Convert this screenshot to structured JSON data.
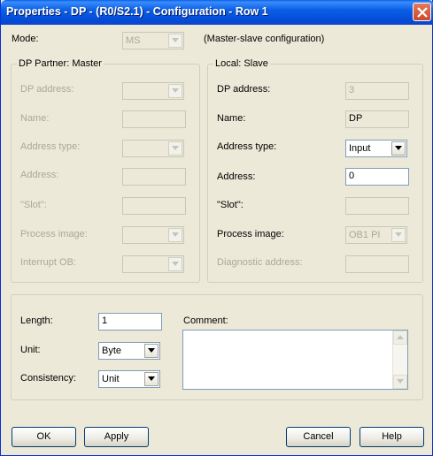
{
  "window": {
    "title": "Properties - DP - (R0/S2.1) - Configuration - Row 1"
  },
  "mode": {
    "label": "Mode:",
    "value": "MS",
    "description": "(Master-slave configuration)"
  },
  "partner": {
    "legend": "DP Partner: Master",
    "dp_address_label": "DP address:",
    "name_label": "Name:",
    "address_type_label": "Address type:",
    "address_label": "Address:",
    "slot_label": "\"Slot\":",
    "process_image_label": "Process image:",
    "interrupt_ob_label": "Interrupt OB:"
  },
  "local": {
    "legend": "Local: Slave",
    "dp_address_label": "DP address:",
    "dp_address_value": "3",
    "name_label": "Name:",
    "name_value": "DP",
    "address_type_label": "Address type:",
    "address_type_value": "Input",
    "address_label": "Address:",
    "address_value": "0",
    "slot_label": "\"Slot\":",
    "process_image_label": "Process image:",
    "process_image_value": "OB1 PI",
    "diagnostic_label": "Diagnostic address:"
  },
  "data": {
    "length_label": "Length:",
    "length_value": "1",
    "unit_label": "Unit:",
    "unit_value": "Byte",
    "consistency_label": "Consistency:",
    "consistency_value": "Unit",
    "comment_label": "Comment:"
  },
  "buttons": {
    "ok": "OK",
    "apply": "Apply",
    "cancel": "Cancel",
    "help": "Help"
  },
  "colors": {
    "titlebar": "#0a5fe6",
    "dialog_bg": "#ece9d8",
    "disabled_text": "#aca899",
    "border": "#7f9db9"
  }
}
